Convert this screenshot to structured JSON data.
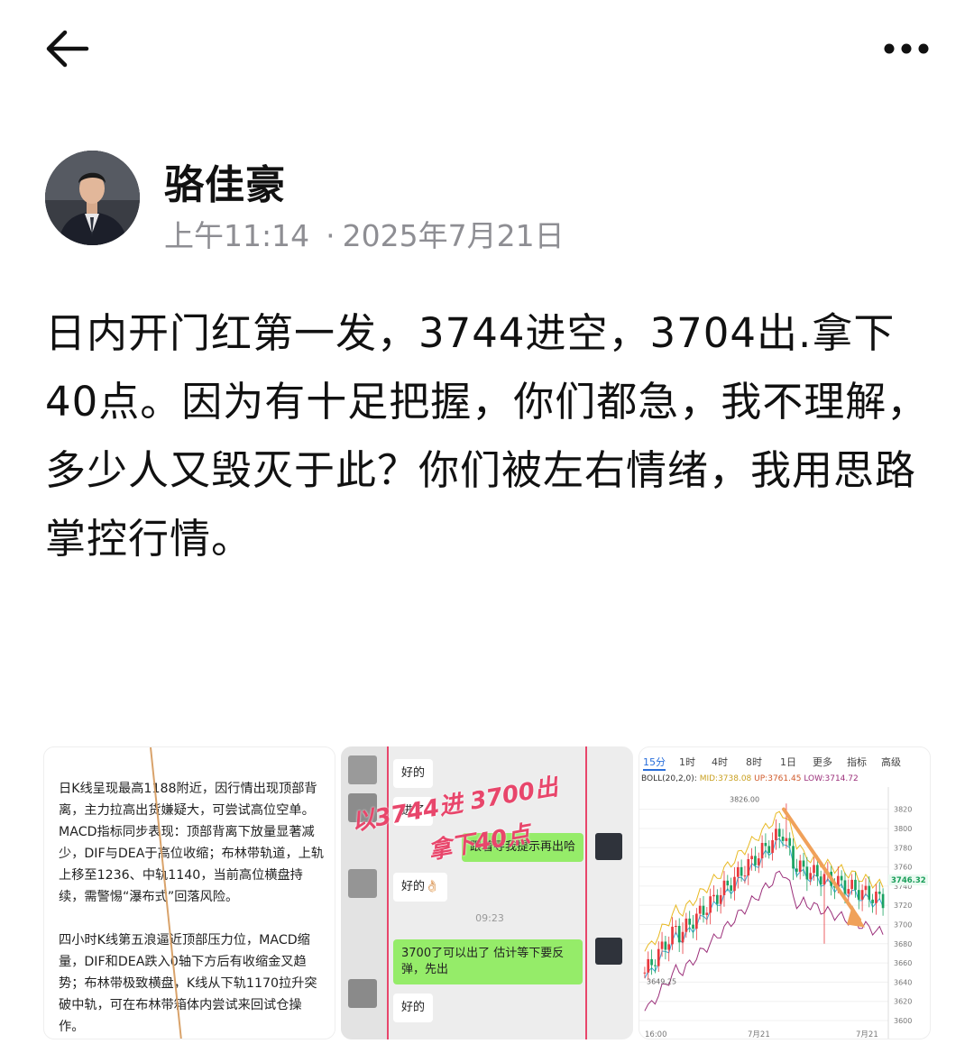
{
  "post": {
    "author_name": "骆佳豪",
    "time": "上午11:14",
    "dot": "·",
    "date": "2025年7月21日",
    "text": "日内开门红第一发，3744进空，3704出.拿下40点。因为有十足把握，你们都急，我不理解，多少人又毁灭于此？你们被左右情绪，我用思路掌控行情。"
  },
  "icons": {
    "back": "arrow-left-icon",
    "more": "more-dots-icon"
  },
  "image1": {
    "paragraph1": "日K线呈现最高1188附近，因行情出现顶部背离，主力拉高出货嫌疑大，可尝试高位空单。MACD指标同步表现：顶部背离下放量显著减少，DIF与DEA于高位收缩；布林带轨道，上轨上移至1236、中轨1140，当前高位横盘持续，需警惕“瀑布式”回落风险。",
    "paragraph2": "四小时K线第五浪逼近顶部压力位，MACD缩量，DIF和DEA跌入0轴下方后有收缩金叉趋势；布林带极致横盘，K线从下轨1170拉升突破中轨，可在布林带箱体内尝试来回试仓操作。"
  },
  "image2": {
    "msg1": "好的",
    "msg2": "进了",
    "msg3": "跟着导我提示再出哈",
    "msg4": "好的👌🏻",
    "time": "09:23",
    "msg5": "3700了可以出了 估计等下要反弹，先出",
    "msg6": "好的",
    "stamp1": "以3744进  3700出",
    "stamp2": "拿下40点"
  },
  "image3": {
    "tabs": [
      "15分",
      "1时",
      "4时",
      "8时",
      "1日",
      "更多",
      "指标",
      "高级"
    ],
    "active_tab": "15分",
    "boll_name": "BOLL(20,2,0):",
    "boll_mid": "MID:3738.08",
    "boll_up": "UP:3761.45",
    "boll_low": "LOW:3714.72",
    "high_label": "3826.00",
    "low_label": "3649.25",
    "last_price": "3746.32",
    "x_labels": [
      "16:00",
      "7月21",
      "7月21"
    ],
    "colors": {
      "up": "#e8383d",
      "down": "#1aa260",
      "mid": "#e8b923",
      "low_band": "#9b2f7a",
      "arrow": "#f0a15a"
    }
  },
  "chart_data": {
    "type": "candlestick",
    "title": "",
    "xlabel": "",
    "ylabel": "",
    "x": [
      "16:00",
      "7月21",
      "7月21"
    ],
    "y_ticks": [
      3820,
      3800,
      3780,
      3760,
      3740,
      3720,
      3700,
      3680,
      3660,
      3640,
      3620,
      3600
    ],
    "ylim": [
      3600,
      3830
    ],
    "annotations": [
      "3826.00",
      "3649.25",
      "3746.32"
    ],
    "grid": true,
    "series": [
      {
        "name": "BOLL MID",
        "value": 3738.08
      },
      {
        "name": "BOLL UP",
        "value": 3761.45
      },
      {
        "name": "BOLL LOW",
        "value": 3714.72
      }
    ]
  }
}
